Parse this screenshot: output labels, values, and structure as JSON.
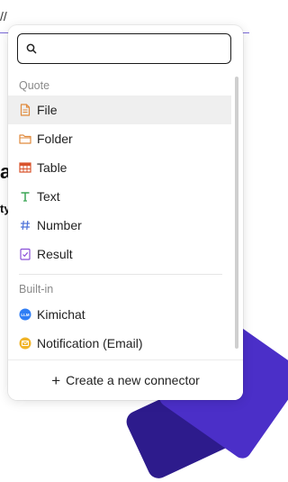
{
  "background": {
    "top_text": "//",
    "frag_a": "ac",
    "frag_ty": "ty"
  },
  "search": {
    "value": "",
    "placeholder": ""
  },
  "sections": [
    {
      "label": "Quote",
      "items": [
        {
          "label": "File",
          "icon": "file-icon",
          "color": "#e08a3c"
        },
        {
          "label": "Folder",
          "icon": "folder-icon",
          "color": "#e08a3c"
        },
        {
          "label": "Table",
          "icon": "table-icon",
          "color": "#d9532c"
        },
        {
          "label": "Text",
          "icon": "text-icon",
          "color": "#3aa655"
        },
        {
          "label": "Number",
          "icon": "hash-icon",
          "color": "#4a6fd8"
        },
        {
          "label": "Result",
          "icon": "result-icon",
          "color": "#8a4fd8"
        }
      ]
    },
    {
      "label": "Built-in",
      "items": [
        {
          "label": "Kimichat",
          "icon": "kimichat-icon",
          "color": "#2f7ef5"
        },
        {
          "label": "Notification (Email)",
          "icon": "email-icon",
          "color": "#f0b429"
        }
      ]
    }
  ],
  "footer": {
    "label": "Create a new connector"
  }
}
